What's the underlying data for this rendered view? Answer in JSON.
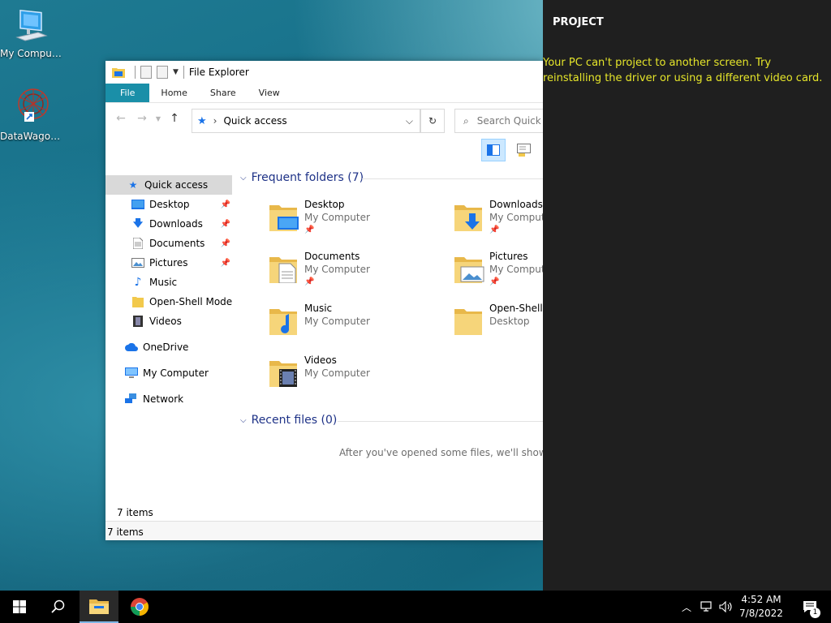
{
  "desktop": {
    "icons": [
      {
        "label": "My Computer",
        "icon": "computer-icon"
      },
      {
        "label": "DataWagon...",
        "icon": "datawagon-app-icon"
      }
    ]
  },
  "explorer": {
    "title": "File Explorer",
    "ribbon_tabs": [
      "File",
      "Home",
      "Share",
      "View"
    ],
    "address": "Quick access",
    "search_placeholder": "Search Quick",
    "nav": {
      "quick_access": "Quick access",
      "items": [
        {
          "label": "Desktop",
          "pinned": true
        },
        {
          "label": "Downloads",
          "pinned": true
        },
        {
          "label": "Documents",
          "pinned": true
        },
        {
          "label": "Pictures",
          "pinned": true
        },
        {
          "label": "Music",
          "pinned": false
        },
        {
          "label": "Open-Shell Modern",
          "pinned": false
        },
        {
          "label": "Videos",
          "pinned": false
        }
      ],
      "onedrive": "OneDrive",
      "my_computer": "My Computer",
      "network": "Network"
    },
    "frequent_header": "Frequent folders (7)",
    "folders": [
      {
        "name": "Desktop",
        "location": "My Computer",
        "pinned": true
      },
      {
        "name": "Downloads",
        "location": "My Computer",
        "pinned": true
      },
      {
        "name": "Documents",
        "location": "My Computer",
        "pinned": true
      },
      {
        "name": "Pictures",
        "location": "My Computer",
        "pinned": true
      },
      {
        "name": "Music",
        "location": "My Computer",
        "pinned": false
      },
      {
        "name": "Open-Shell Modern",
        "location": "Desktop",
        "pinned": false
      },
      {
        "name": "Videos",
        "location": "My Computer",
        "pinned": false
      }
    ],
    "recent_header": "Recent files (0)",
    "recent_empty": "After you've opened some files, we'll show the most recent ones here.",
    "item_count": "7 items",
    "status_bar": "7 items"
  },
  "project": {
    "title": "PROJECT",
    "message": "Your PC can't project to another screen. Try reinstalling the driver or using a different video card."
  },
  "taskbar": {
    "time": "4:52 AM",
    "date": "7/8/2022",
    "notification_count": "1"
  },
  "colors": {
    "accent": "#1a8fa8",
    "project_text": "#e6e62a",
    "group_header": "#1e3287"
  }
}
